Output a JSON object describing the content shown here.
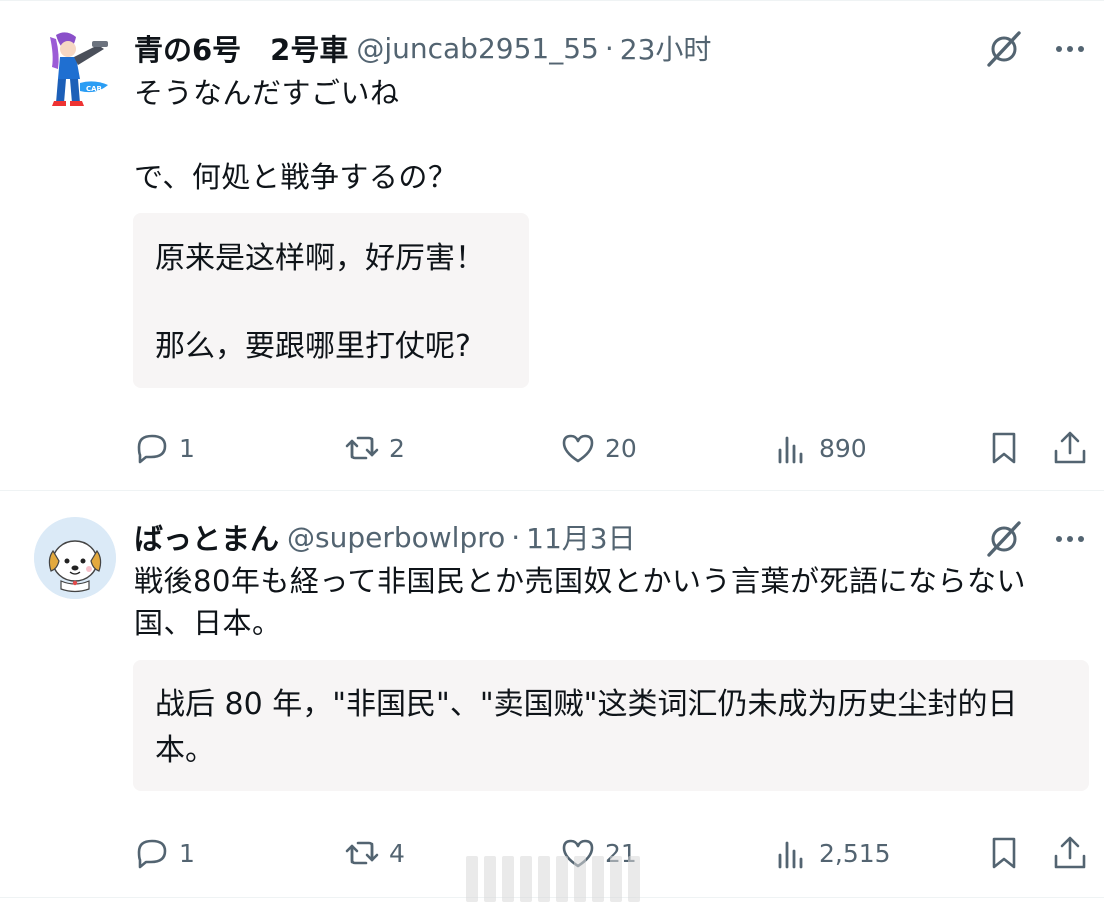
{
  "colors": {
    "text": "#0f1419",
    "secondary": "#536471",
    "translation_bg": "#f7f5f5",
    "divider": "#eff3f4"
  },
  "tweets": [
    {
      "display_name": "青の6号　2号車",
      "handle": "@juncab2951_55",
      "separator": "·",
      "time": "23小时",
      "avatar_icon": "anime-character-avatar",
      "text": "そうなんだすごいね\n\nで、何処と戦争するの？",
      "translation": "原来是这样啊，好厉害！\n\n那么，要跟哪里打仗呢?",
      "actions": {
        "replies": "1",
        "retweets": "2",
        "likes": "20",
        "views": "890"
      }
    },
    {
      "display_name": "ばっとまん",
      "handle": "@superbowlpro",
      "separator": "·",
      "time": "11月3日",
      "avatar_icon": "dog-avatar",
      "text": "戦後80年も経って非国民とか売国奴とかいう言葉が死語にならない国、日本。",
      "translation": "战后 80 年，\"非国民\"、\"卖国贼\"这类词汇仍未成为历史尘封的日本。",
      "actions": {
        "replies": "1",
        "retweets": "4",
        "likes": "21",
        "views": "2,515"
      }
    }
  ]
}
